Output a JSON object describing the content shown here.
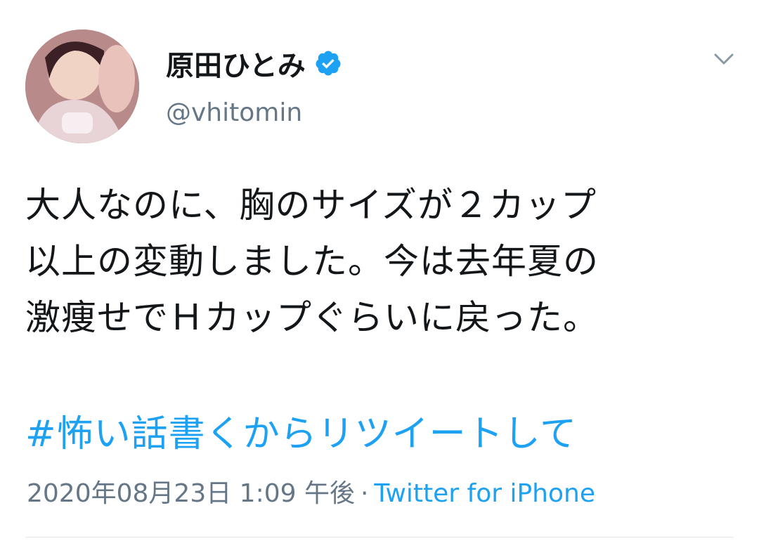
{
  "user": {
    "display_name": "原田ひとみ",
    "handle": "@vhitomin",
    "verified": true
  },
  "tweet": {
    "lines": [
      "大人なのに、胸のサイズが２カップ",
      "以上の変動しました。今は去年夏の",
      "激痩せでＨカップぐらいに戻った。"
    ],
    "hashtag": "#怖い話書くからリツイートして",
    "date": "2020年08月23日 1:09 午後",
    "separator": "·",
    "source": "Twitter for iPhone"
  },
  "icons": {
    "verified": "verified-badge-icon",
    "menu": "chevron-down-icon"
  },
  "colors": {
    "link": "#1da1f2",
    "secondary_text": "#657786",
    "primary_text": "#14171a"
  }
}
